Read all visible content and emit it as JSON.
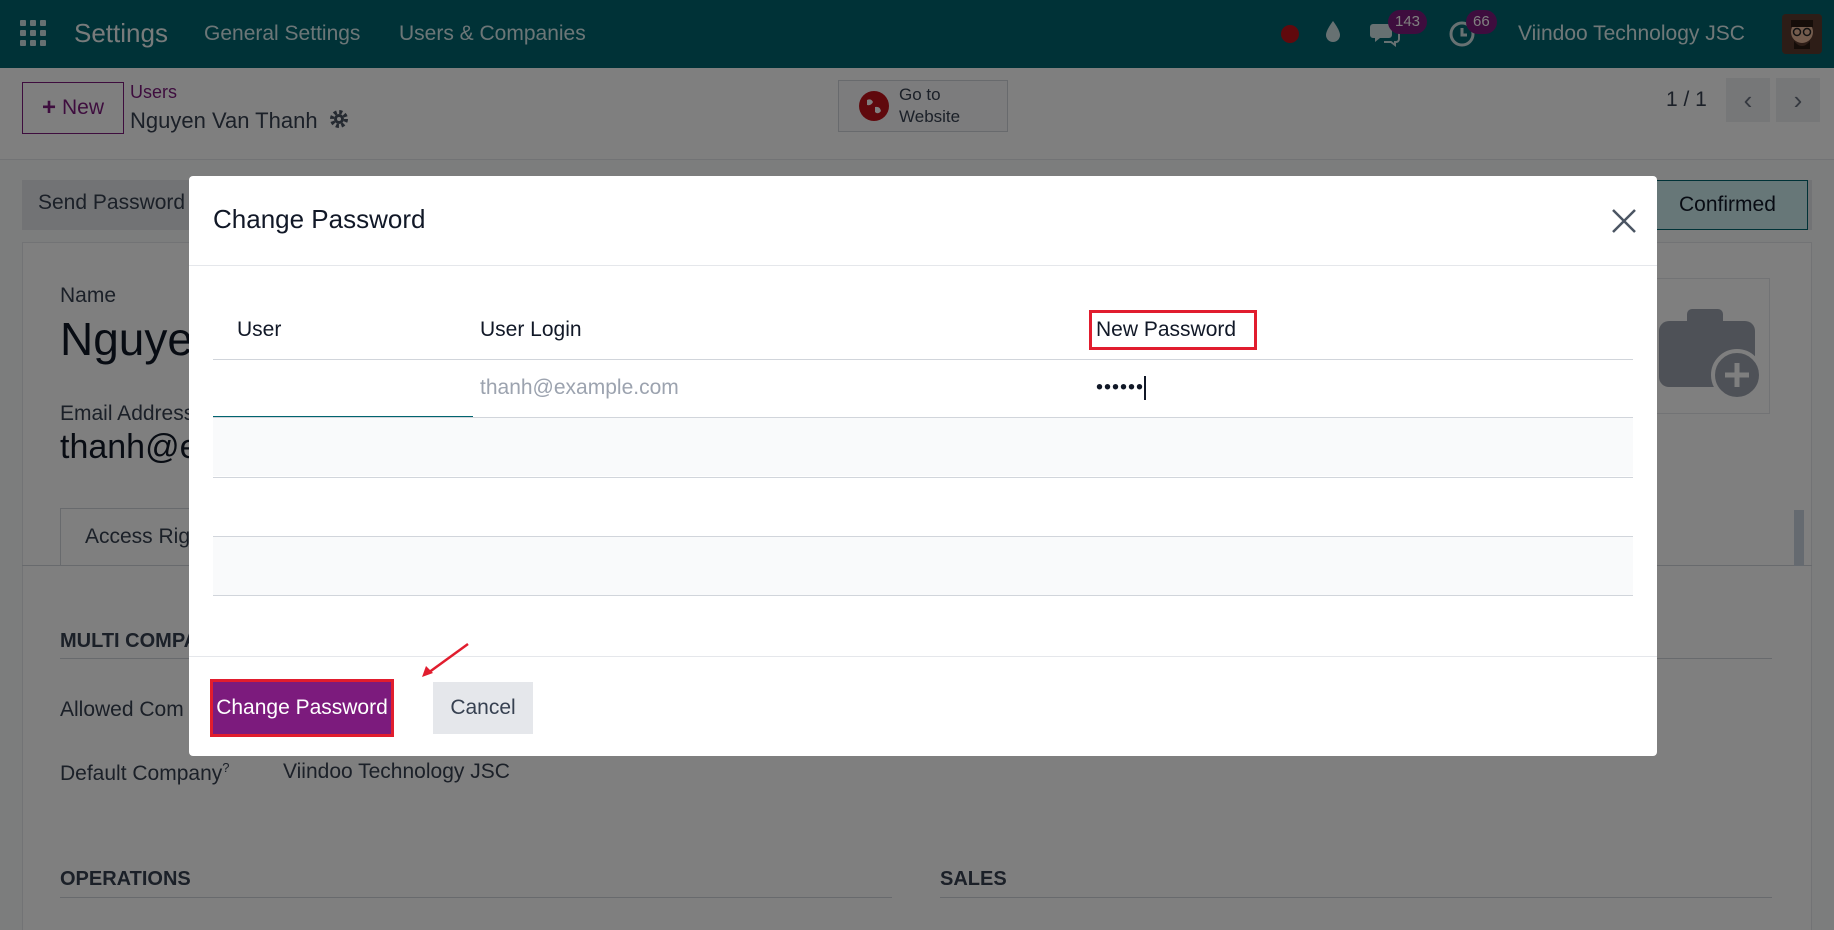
{
  "topbar": {
    "app_title": "Settings",
    "menu": [
      "General Settings",
      "Users & Companies"
    ],
    "chat_count": "143",
    "activity_count": "66",
    "company": "Viindoo Technology JSC"
  },
  "control_panel": {
    "new_label": "New",
    "breadcrumb_parent": "Users",
    "record_name": "Nguyen Van Thanh",
    "website_button": "Go to\nWebsite",
    "pager": "1 / 1"
  },
  "form": {
    "send_password_label": "Send Password",
    "status": "Confirmed",
    "name_label": "Name",
    "name_value": "Nguye",
    "email_label": "Email Address",
    "email_value": "thanh@e",
    "tab_access": "Access Rig",
    "multi_company_section": "MULTI COMPA",
    "allowed_companies_label": "Allowed Com",
    "default_company_label": "Default Company",
    "default_company_help": "?",
    "default_company_value": "Viindoo Technology JSC",
    "operations_section": "OPERATIONS",
    "sales_section": "SALES"
  },
  "modal": {
    "title": "Change Password",
    "columns": [
      "User",
      "User Login",
      "New Password"
    ],
    "row": {
      "user": "",
      "user_login_placeholder": "thanh@example.com",
      "new_password": "••••••"
    },
    "primary_button": "Change Password",
    "cancel_button": "Cancel"
  },
  "colors": {
    "navbar": "#01646f",
    "brand": "#7c1b7d",
    "highlight": "#e11d2e"
  }
}
